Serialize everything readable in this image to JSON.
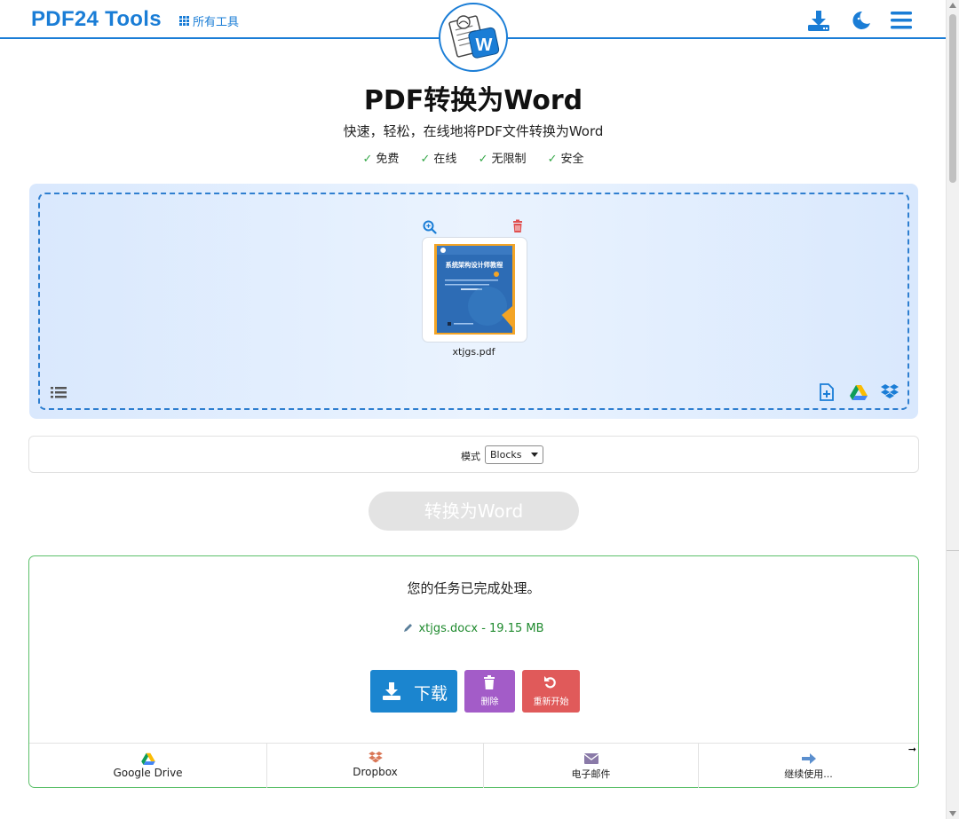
{
  "header": {
    "logo": "PDF24 Tools",
    "all_tools": "所有工具"
  },
  "hero": {
    "title": "PDF转换为Word",
    "subtitle": "快速，轻松，在线地将PDF文件转换为Word",
    "features": [
      "免费",
      "在线",
      "无限制",
      "安全"
    ],
    "badge_letter": "W"
  },
  "dropzone": {
    "file_name": "xtjgs.pdf",
    "cover_title": "系统架构设计师教程"
  },
  "options": {
    "mode_label": "模式",
    "mode_value": "Blocks"
  },
  "convert_button": "转换为Word",
  "result": {
    "message": "您的任务已完成处理。",
    "file": "xtjgs.docx - 19.15 MB",
    "download": "下载",
    "delete": "删除",
    "restart": "重新开始",
    "share": [
      {
        "label": "Google Drive",
        "icon": "google-drive-icon"
      },
      {
        "label": "Dropbox",
        "icon": "dropbox-icon"
      },
      {
        "label": "电子邮件",
        "icon": "mail-icon"
      },
      {
        "label": "继续使用...",
        "icon": "arrow-right-icon"
      }
    ]
  },
  "colors": {
    "brand": "#1a7dd6",
    "success": "#5cc06a",
    "download": "#1b85cf",
    "delete": "#a35cc8",
    "restart": "#e05a5a"
  }
}
